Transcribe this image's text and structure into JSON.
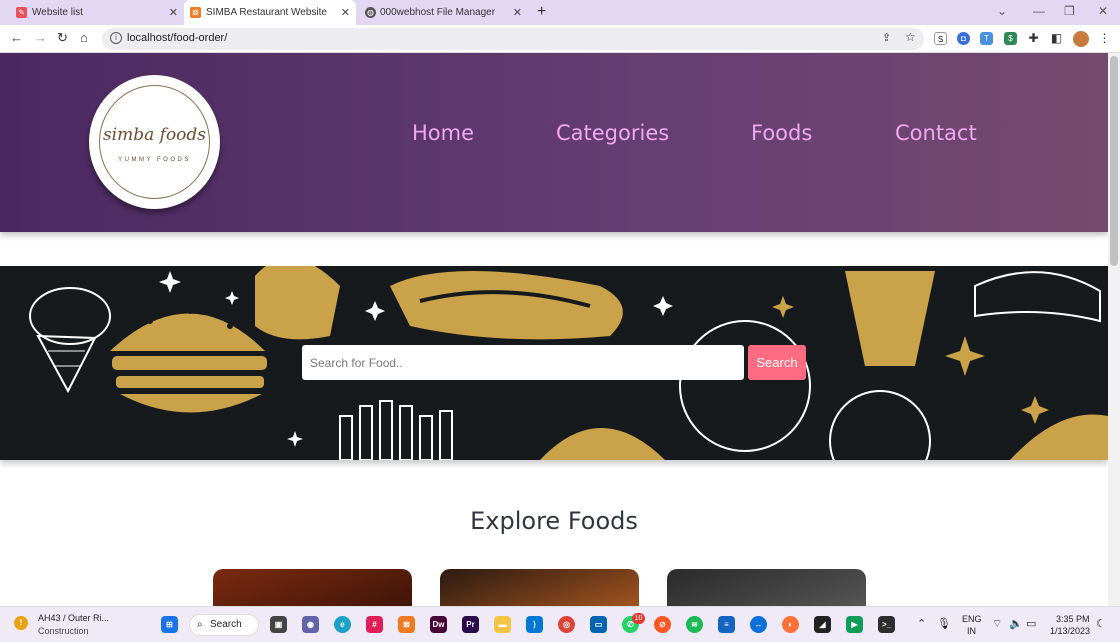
{
  "browser": {
    "tabs": [
      {
        "title": "Website list",
        "active": false
      },
      {
        "title": "SIMBA Restaurant Website",
        "active": true
      },
      {
        "title": "000webhost File Manager",
        "active": false
      }
    ],
    "url": "localhost/food-order/"
  },
  "site": {
    "logo": {
      "script": "simba foods",
      "tagline": "YUMMY FOODS"
    },
    "nav": [
      "Home",
      "Categories",
      "Foods",
      "Contact"
    ],
    "search": {
      "placeholder": "Search for Food..",
      "button": "Search"
    },
    "explore_title": "Explore Foods"
  },
  "taskbar": {
    "weather": {
      "title": "AH43 / Outer Ri...",
      "subtitle": "Construction"
    },
    "search_label": "Search",
    "badge": "10",
    "lang": {
      "line1": "ENG",
      "line2": "IN"
    },
    "time": "3:35 PM",
    "date": "1/13/2023"
  },
  "colors": {
    "header_start": "#4b2860",
    "nav_link": "#f0a8f0",
    "search_button": "#ff6b81",
    "hero_bg": "#161a1d",
    "hero_art": "#c9a24a"
  }
}
